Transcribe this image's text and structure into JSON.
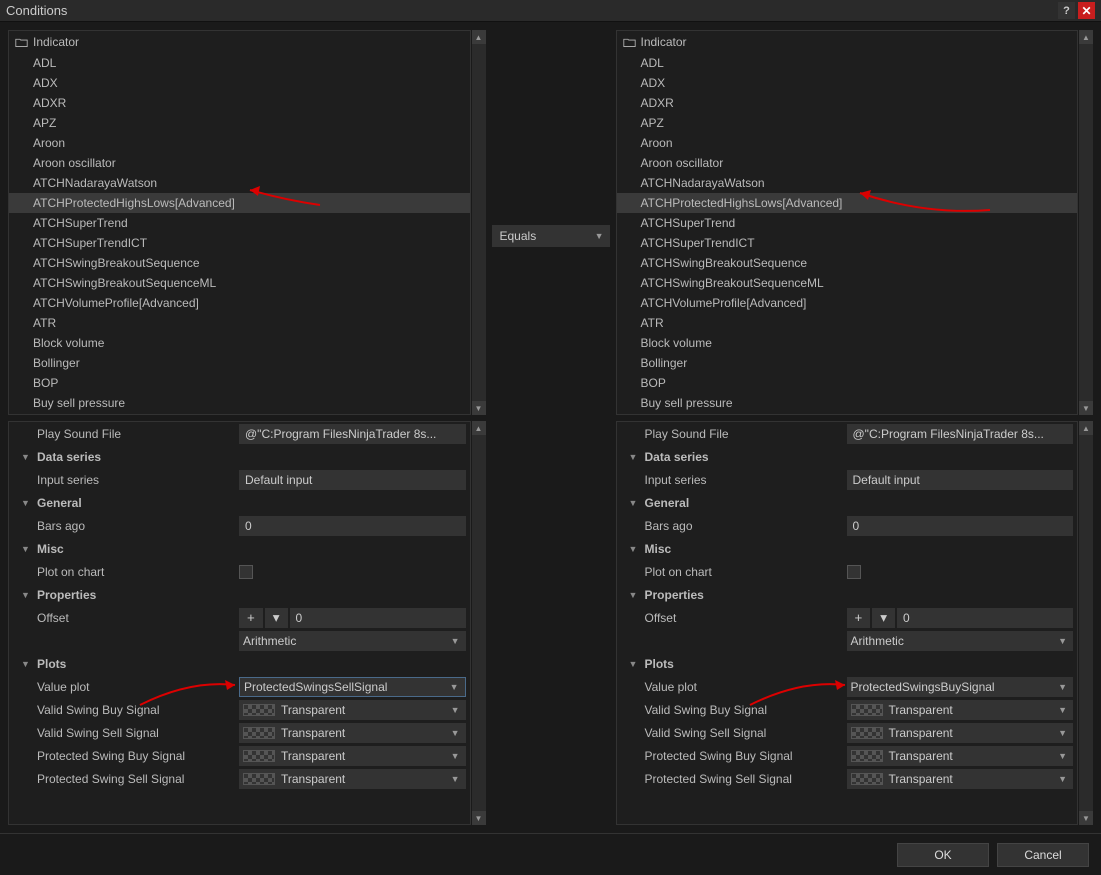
{
  "window": {
    "title": "Conditions"
  },
  "operator": {
    "selected": "Equals"
  },
  "left": {
    "tree": {
      "header": "Indicator",
      "items": [
        "ADL",
        "ADX",
        "ADXR",
        "APZ",
        "Aroon",
        "Aroon oscillator",
        "ATCHNadarayaWatson",
        "ATCHProtectedHighsLows[Advanced]",
        "ATCHSuperTrend",
        "ATCHSuperTrendICT",
        "ATCHSwingBreakoutSequence",
        "ATCHSwingBreakoutSequenceML",
        "ATCHVolumeProfile[Advanced]",
        "ATR",
        "Block volume",
        "Bollinger",
        "BOP",
        "Buy sell pressure"
      ]
    },
    "props": {
      "play_sound_label": "Play Sound File",
      "play_sound_value": "@\"C:Program FilesNinjaTrader 8s...",
      "data_series_header": "Data series",
      "input_series_label": "Input series",
      "input_series_value": "Default input",
      "general_header": "General",
      "bars_ago_label": "Bars ago",
      "bars_ago_value": "0",
      "misc_header": "Misc",
      "plot_on_chart_label": "Plot on chart",
      "properties_header": "Properties",
      "offset_label": "Offset",
      "offset_btn": "+",
      "offset_value": "0",
      "offset_mode": "Arithmetic",
      "plots_header": "Plots",
      "value_plot_label": "Value plot",
      "value_plot_selected": "ProtectedSwingsSellSignal",
      "valid_buy_label": "Valid Swing Buy Signal",
      "valid_sell_label": "Valid Swing Sell Signal",
      "protected_buy_label": "Protected Swing Buy Signal",
      "protected_sell_label": "Protected Swing Sell Signal",
      "transparent": "Transparent"
    }
  },
  "right": {
    "tree": {
      "header": "Indicator",
      "items": [
        "ADL",
        "ADX",
        "ADXR",
        "APZ",
        "Aroon",
        "Aroon oscillator",
        "ATCHNadarayaWatson",
        "ATCHProtectedHighsLows[Advanced]",
        "ATCHSuperTrend",
        "ATCHSuperTrendICT",
        "ATCHSwingBreakoutSequence",
        "ATCHSwingBreakoutSequenceML",
        "ATCHVolumeProfile[Advanced]",
        "ATR",
        "Block volume",
        "Bollinger",
        "BOP",
        "Buy sell pressure"
      ]
    },
    "props": {
      "play_sound_label": "Play Sound File",
      "play_sound_value": "@\"C:Program FilesNinjaTrader 8s...",
      "data_series_header": "Data series",
      "input_series_label": "Input series",
      "input_series_value": "Default input",
      "general_header": "General",
      "bars_ago_label": "Bars ago",
      "bars_ago_value": "0",
      "misc_header": "Misc",
      "plot_on_chart_label": "Plot on chart",
      "properties_header": "Properties",
      "offset_label": "Offset",
      "offset_btn": "+",
      "offset_value": "0",
      "offset_mode": "Arithmetic",
      "plots_header": "Plots",
      "value_plot_label": "Value plot",
      "value_plot_selected": "ProtectedSwingsBuySignal",
      "valid_buy_label": "Valid Swing Buy Signal",
      "valid_sell_label": "Valid Swing Sell Signal",
      "protected_buy_label": "Protected Swing Buy Signal",
      "protected_sell_label": "Protected Swing Sell Signal",
      "transparent": "Transparent"
    }
  },
  "footer": {
    "ok": "OK",
    "cancel": "Cancel"
  }
}
